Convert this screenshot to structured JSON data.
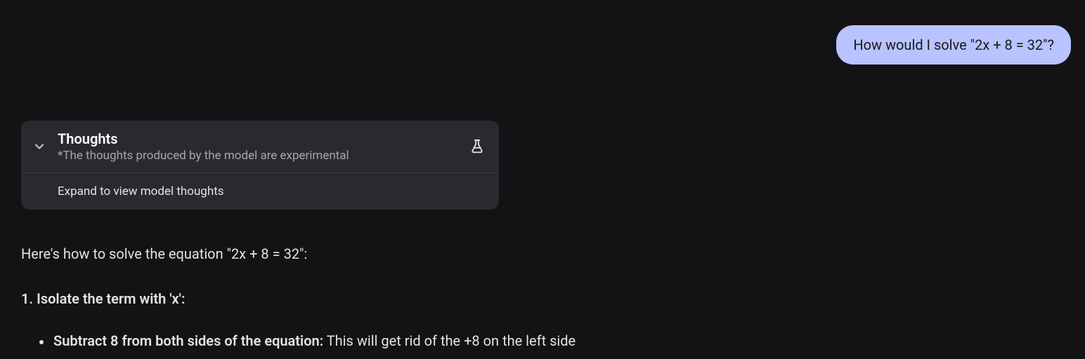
{
  "user_message": "How would I solve \"2x + 8 = 32\"?",
  "thoughts": {
    "title": "Thoughts",
    "subtitle": "*The thoughts produced by the model are experimental",
    "expand_text": "Expand to view model thoughts"
  },
  "answer": {
    "intro": "Here's how to solve the equation \"2x + 8 = 32\":",
    "step1_heading": "1. Isolate the term with 'x':",
    "bullet1_bold": "Subtract 8 from both sides of the equation:",
    "bullet1_rest": " This will get rid of the +8 on the left side"
  }
}
